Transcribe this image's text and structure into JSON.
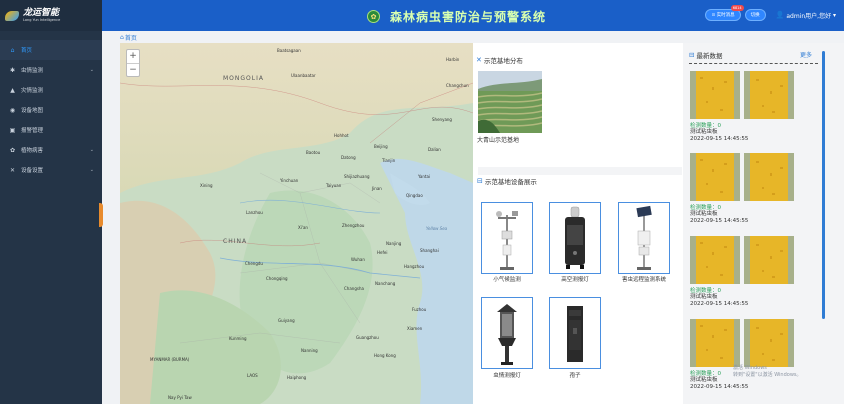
{
  "logo": {
    "name": "龙运智能",
    "tagline": "Long Yun Intelligence"
  },
  "header": {
    "title": "森林病虫害防治与预警系统",
    "realtime_label": "实时消息",
    "realtime_badge": "6814",
    "switch_label": "切换",
    "user_label": "admin用户,您好"
  },
  "sidebar": {
    "items": [
      {
        "label": "首页",
        "icon": "home-icon",
        "active": true
      },
      {
        "label": "虫情监测",
        "icon": "bug-icon",
        "chevron": "›"
      },
      {
        "label": "灾情监测",
        "icon": "fire-icon"
      },
      {
        "label": "设备地图",
        "icon": "map-icon"
      },
      {
        "label": "报警管理",
        "icon": "alarm-icon"
      },
      {
        "label": "植物病害",
        "icon": "plant-icon",
        "chevron": "›"
      },
      {
        "label": "设备设置",
        "icon": "settings-icon",
        "chevron": "›"
      }
    ]
  },
  "breadcrumb": {
    "label": "首页"
  },
  "map": {
    "labels": [
      {
        "text": "Baatsagaan"
      },
      {
        "text": "Ulaanbaatar"
      },
      {
        "text": "MONGOLIA"
      },
      {
        "text": "Baotou"
      },
      {
        "text": "Beijing"
      },
      {
        "text": "Datong"
      },
      {
        "text": "Tianjin"
      },
      {
        "text": "Shijiazhuang"
      },
      {
        "text": "Taiyuan"
      },
      {
        "text": "Jinan"
      },
      {
        "text": "Qingdao"
      },
      {
        "text": "Yantai"
      },
      {
        "text": "Lanzhou"
      },
      {
        "text": "Xi'an"
      },
      {
        "text": "Zhengzhou"
      },
      {
        "text": "Nanjing"
      },
      {
        "text": "Shanghai"
      },
      {
        "text": "Wuhan"
      },
      {
        "text": "Hefei"
      },
      {
        "text": "Hangzhou"
      },
      {
        "text": "Chengdu"
      },
      {
        "text": "Chongqing"
      },
      {
        "text": "Changsha"
      },
      {
        "text": "Nanchang"
      },
      {
        "text": "Fuzhou"
      },
      {
        "text": "Guiyang"
      },
      {
        "text": "Kunming"
      },
      {
        "text": "Guangzhou"
      },
      {
        "text": "Xiamen"
      },
      {
        "text": "Nanning"
      },
      {
        "text": "Hong Kong"
      },
      {
        "text": "CHINA"
      },
      {
        "text": "MYANMAR (BURMA)"
      },
      {
        "text": "LAOS"
      },
      {
        "text": "Haiphong"
      },
      {
        "text": "Yellow Sea"
      },
      {
        "text": "Harbin"
      },
      {
        "text": "Changchun"
      },
      {
        "text": "Shenyang"
      },
      {
        "text": "Dalian"
      },
      {
        "text": "Hohhot"
      },
      {
        "text": "Xining"
      },
      {
        "text": "Yinchuan"
      },
      {
        "text": "Nay Pyi Taw"
      }
    ]
  },
  "demo_base": {
    "title": "示范基地分布",
    "caption": "大青山示范基地"
  },
  "devices": {
    "title": "示范基地设备展示",
    "items": [
      {
        "label": "小气候监测"
      },
      {
        "label": "高空测报灯"
      },
      {
        "label": "害虫远程监测系统"
      },
      {
        "label": "虫情测报灯"
      },
      {
        "label": "孢子"
      }
    ]
  },
  "latest": {
    "title": "最新数据",
    "more": "更多",
    "records": [
      {
        "count": "检测数量：0",
        "name": "测试粘虫板",
        "time": "2022-09-15 14:45:55"
      },
      {
        "count": "检测数量：0",
        "name": "测试粘虫板",
        "time": "2022-09-15 14:45:55"
      },
      {
        "count": "检测数量：0",
        "name": "测试粘虫板",
        "time": "2022-09-15 14:45:55"
      },
      {
        "count": "检测数量：0",
        "name": "测试粘虫板",
        "time": "2022-09-15 14:45:55"
      }
    ]
  },
  "watermark": {
    "line1": "激活 Windows",
    "line2": "转到\"设置\"以激活 Windows。"
  },
  "colors": {
    "header": "#1a5fc8",
    "sidebar": "#243447",
    "accent": "#2f7cd4",
    "title": "#d8ffb0",
    "count": "#2ba05a"
  }
}
